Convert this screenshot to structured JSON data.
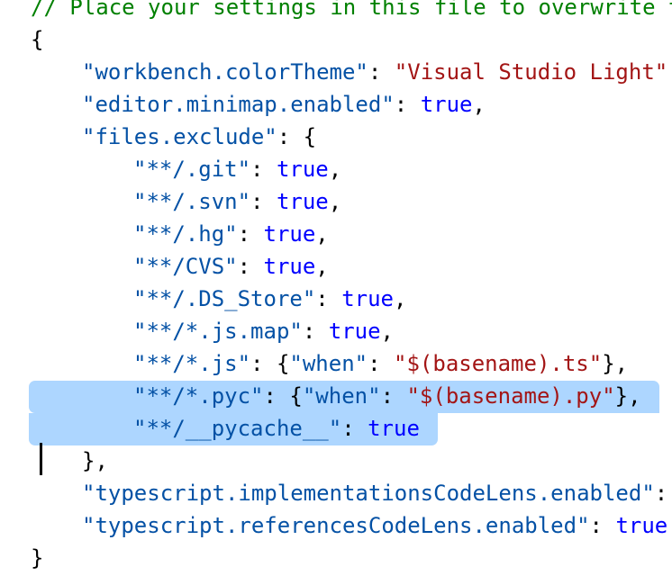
{
  "editor": {
    "comment": "// Place your settings in this file to overwrite t",
    "open_brace": "{",
    "close_brace": "}",
    "settings": {
      "color_theme_key": "\"workbench.colorTheme\"",
      "color_theme_value": "\"Visual Studio Light\"",
      "minimap_key": "\"editor.minimap.enabled\"",
      "minimap_value": "true",
      "files_exclude_key": "\"files.exclude\"",
      "impl_codelens_key": "\"typescript.implementationsCodeLens.enabled\"",
      "refs_codelens_key": "\"typescript.referencesCodeLens.enabled\"",
      "refs_codelens_value": "true"
    },
    "exclude_entries": [
      {
        "key": "\"**/.git\"",
        "value": "true"
      },
      {
        "key": "\"**/.svn\"",
        "value": "true"
      },
      {
        "key": "\"**/.hg\"",
        "value": "true"
      },
      {
        "key": "\"**/CVS\"",
        "value": "true"
      },
      {
        "key": "\"**/.DS_Store\"",
        "value": "true"
      },
      {
        "key": "\"**/*.js.map\"",
        "value": "true"
      },
      {
        "key": "\"**/*.js\"",
        "when_key": "\"when\"",
        "when_value": "\"$(basename).ts\""
      },
      {
        "key": "\"**/*.pyc\"",
        "when_key": "\"when\"",
        "when_value": "\"$(basename).py\""
      },
      {
        "key": "\"**/__pycache__\"",
        "value": "true"
      }
    ]
  }
}
